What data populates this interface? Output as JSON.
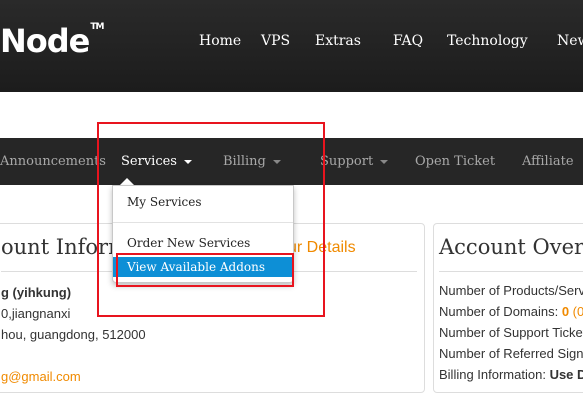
{
  "header": {
    "logo_prefix": "",
    "logo_text": "Node",
    "logo_tm": "TM",
    "nav": [
      "Home",
      "VPS",
      "Extras",
      "FAQ",
      "Technology",
      "New"
    ]
  },
  "menubar": {
    "items": [
      "Announcements",
      "Services",
      "Billing",
      "Support",
      "Open Ticket",
      "Affiliate"
    ]
  },
  "dropdown": {
    "items": [
      "My Services",
      "Order New Services",
      "View Available Addons"
    ]
  },
  "account_info": {
    "title": "ount Inform",
    "update_link": "ur Details",
    "name": "g (yihkung)",
    "address1": "0,jiangnanxi",
    "address2": "hou, guangdong, 512000",
    "email": "g@gmail.com"
  },
  "account_overview": {
    "title": "Account Overv",
    "products_label": "Number of Products/Serv",
    "domains_label": "Number of Domains: ",
    "domains_value": "0",
    "domains_suffix": " (0",
    "tickets_label": "Number of Support Ticket",
    "referred_label": "Number of Referred Signu",
    "billing_label": "Billing Information: ",
    "billing_value": "Use D"
  },
  "colors": {
    "accent": "#f08a00",
    "highlight": "#0d8fd6",
    "annotation": "#e8141e"
  }
}
